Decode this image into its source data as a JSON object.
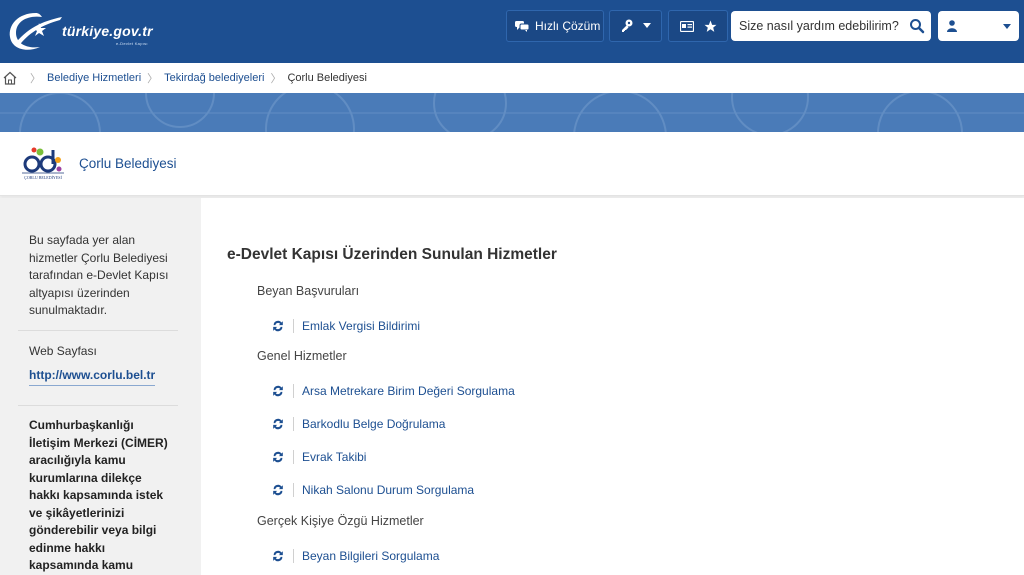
{
  "header": {
    "logo_text": "türkiye.gov.tr",
    "logo_subtext": "e-Devlet Kapısı",
    "quick_solution": "Hızlı Çözüm",
    "search_placeholder": "Size nasıl yardım edebilirim?",
    "colors": {
      "primary": "#1d4f91",
      "banner": "#4a7bb8"
    }
  },
  "breadcrumb": {
    "items": [
      "Belediye Hizmetleri",
      "Tekirdağ belediyeleri"
    ],
    "current": "Çorlu Belediyesi"
  },
  "institution": {
    "name": "Çorlu Belediyesi",
    "logo_caption": "ÇORLU BELEDİYESİ"
  },
  "sidebar": {
    "intro": "Bu sayfada yer alan hizmetler Çorlu Belediyesi tarafından e-Devlet Kapısı altyapısı üzerinden sunulmaktadır.",
    "web_label": "Web Sayfası",
    "web_url": "http://www.corlu.bel.tr",
    "cimer_text": "Cumhurbaşkanlığı İletişim Merkezi (CİMER) aracılığıyla kamu kurumlarına dilekçe hakkı kapsamında istek ve şikâyetlerinizi gönderebilir veya bilgi edinme hakkı kapsamında kamu"
  },
  "main": {
    "title": "e-Devlet Kapısı Üzerinden Sunulan Hizmetler",
    "categories": [
      {
        "name": "Beyan Başvuruları",
        "services": [
          "Emlak Vergisi Bildirimi"
        ]
      },
      {
        "name": "Genel Hizmetler",
        "services": [
          "Arsa Metrekare Birim Değeri Sorgulama",
          "Barkodlu Belge Doğrulama",
          "Evrak Takibi",
          "Nikah Salonu Durum Sorgulama"
        ]
      },
      {
        "name": "Gerçek Kişiye Özgü Hizmetler",
        "services": [
          "Beyan Bilgileri Sorgulama"
        ]
      }
    ]
  }
}
